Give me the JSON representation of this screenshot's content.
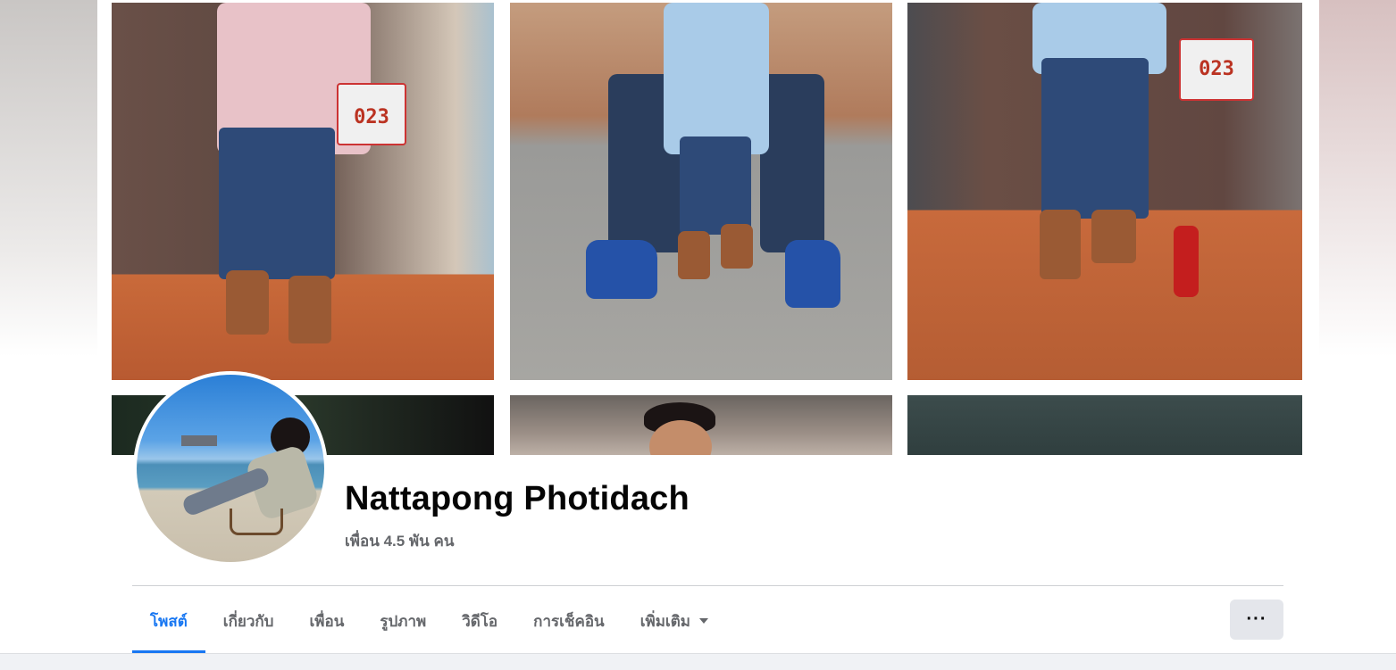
{
  "profile": {
    "name": "Nattapong Photidach",
    "friends_count": "เพื่อน 4.5 พัน คน"
  },
  "cover_photos": {
    "plate_numbers": [
      "023",
      "023"
    ]
  },
  "tabs": [
    {
      "label": "โพสต์",
      "active": true
    },
    {
      "label": "เกี่ยวกับ",
      "active": false
    },
    {
      "label": "เพื่อน",
      "active": false
    },
    {
      "label": "รูปภาพ",
      "active": false
    },
    {
      "label": "วิดีโอ",
      "active": false
    },
    {
      "label": "การเช็คอิน",
      "active": false
    },
    {
      "label": "เพิ่มเติม",
      "active": false,
      "has_dropdown": true
    }
  ],
  "more_button": {
    "label": "···",
    "icon": "more-horizontal-icon"
  },
  "colors": {
    "accent": "#1877f2",
    "tab_text": "#65676b",
    "name_text": "#050505",
    "button_bg": "#e4e6eb",
    "page_bg": "#f0f2f5"
  }
}
